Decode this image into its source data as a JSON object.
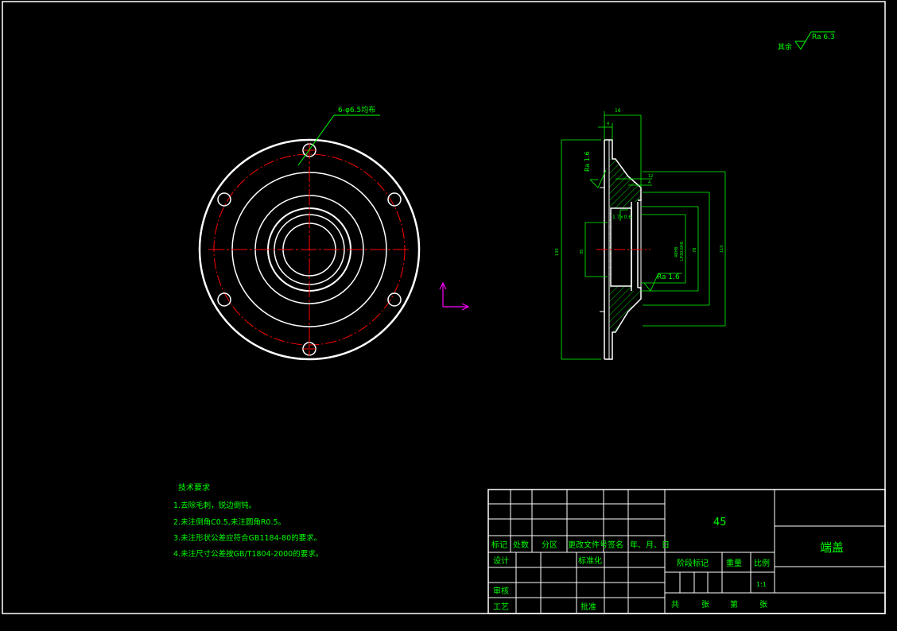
{
  "colors": {
    "background": "#000000",
    "outline": "#ffffff",
    "dimension": "#00ff00",
    "centerline": "#ff0000",
    "ucs_icon": "#ff00ff"
  },
  "roughness": {
    "default_prefix": "其余",
    "default_value": "Ra 6.3",
    "face_1": "Ra 1.6",
    "face_2": "Ra 1.6"
  },
  "front_view": {
    "hole_callout": "6-φ6.5均布"
  },
  "section_view": {
    "dims": {
      "top_width": "16",
      "top_small": "4",
      "step_a": "12",
      "step_b": "4",
      "bore_len": "1.7×0.6",
      "left_total": "130",
      "left_inner": "35",
      "right_a": "48H8",
      "right_a2": "LP30.6H8",
      "right_b": "78",
      "right_c": "110"
    }
  },
  "tech_req": {
    "title": "技术要求",
    "items": [
      "1.去除毛刺，锐边倒钝。",
      "2.未注倒角C0.5,未注圆角R0.5。",
      "3.未注形状公差应符合GB1184-80的要求。",
      "4.未注尺寸公差按GB/T1804-2000的要求。"
    ]
  },
  "title_block": {
    "material": "45",
    "part_name": "端盖",
    "rev_headers": [
      "标记",
      "处数",
      "分区",
      "更改文件号",
      "签名",
      "年、月、日"
    ],
    "design": "设计",
    "standardize": "标准化",
    "check": "审核",
    "process": "工艺",
    "approve": "批准",
    "stage_mark": "阶段标记",
    "weight": "重量",
    "scale": "比例",
    "scale_value": "1:1",
    "total": "共",
    "sheets": "张",
    "sheet_no": "第",
    "sheet_no_unit": "张"
  }
}
